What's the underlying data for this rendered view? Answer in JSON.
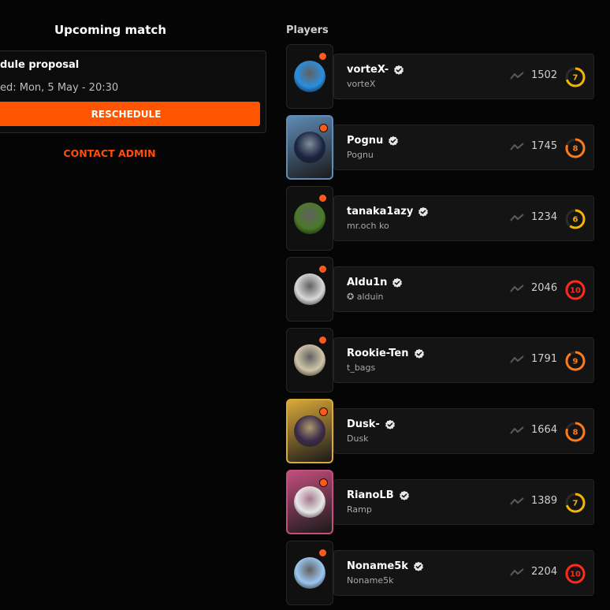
{
  "upcoming": {
    "title": "Upcoming match",
    "proposal_title": "dule proposal",
    "proposal_sub": "ed: Mon, 5 May - 20:30",
    "reschedule_label": "RESCHEDULE",
    "contact_label": "CONTACT ADMIN"
  },
  "players_heading": "Players",
  "colors": {
    "accent": "#ff5400",
    "level_yellow": "#f5b400",
    "level_orange": "#ff7a1a",
    "level_red": "#ff2a1a"
  },
  "players": [
    {
      "name": "vorteX-",
      "sub": "vorteX",
      "elo": "1502",
      "level": "7",
      "level_color": "#f5b400",
      "level_fraction": 0.7,
      "avatar": "panda-avatar",
      "avatar_bg": "#2a8fe0",
      "tile_bg": ""
    },
    {
      "name": "Pognu",
      "sub": "Pognu",
      "elo": "1745",
      "level": "8",
      "level_color": "#ff7a1a",
      "level_fraction": 0.8,
      "avatar": "anime-avatar",
      "avatar_bg": "#1b2440",
      "tile_bg": "#5f8bb5"
    },
    {
      "name": "tanaka1azy",
      "sub": "mr.och ko",
      "elo": "1234",
      "level": "6",
      "level_color": "#f5b400",
      "level_fraction": 0.6,
      "avatar": "character-avatar",
      "avatar_bg": "#4b7a2a",
      "tile_bg": ""
    },
    {
      "name": "Aldu1n",
      "sub": "✪ alduin",
      "elo": "2046",
      "level": "10",
      "level_color": "#ff2a1a",
      "level_fraction": 1.0,
      "avatar": "monochrome-avatar",
      "avatar_bg": "#d8d8d8",
      "tile_bg": ""
    },
    {
      "name": "Rookie-Ten",
      "sub": "t_bags",
      "elo": "1791",
      "level": "9",
      "level_color": "#ff7a1a",
      "level_fraction": 0.9,
      "avatar": "pug-avatar",
      "avatar_bg": "#cfc6a8",
      "tile_bg": ""
    },
    {
      "name": "Dusk-",
      "sub": "Dusk",
      "elo": "1664",
      "level": "8",
      "level_color": "#ff7a1a",
      "level_fraction": 0.8,
      "avatar": "anime-avatar",
      "avatar_bg": "#3a2a4a",
      "tile_bg": "#d9a93a"
    },
    {
      "name": "RianoLB",
      "sub": "Ramp",
      "elo": "1389",
      "level": "7",
      "level_color": "#f5b400",
      "level_fraction": 0.7,
      "avatar": "cat-avatar",
      "avatar_bg": "#e8e8e8",
      "tile_bg": "#c24f7d"
    },
    {
      "name": "Noname5k",
      "sub": "Noname5k",
      "elo": "2204",
      "level": "10",
      "level_color": "#ff2a1a",
      "level_fraction": 1.0,
      "avatar": "astronaut-avatar",
      "avatar_bg": "#9cc6f0",
      "tile_bg": ""
    }
  ]
}
